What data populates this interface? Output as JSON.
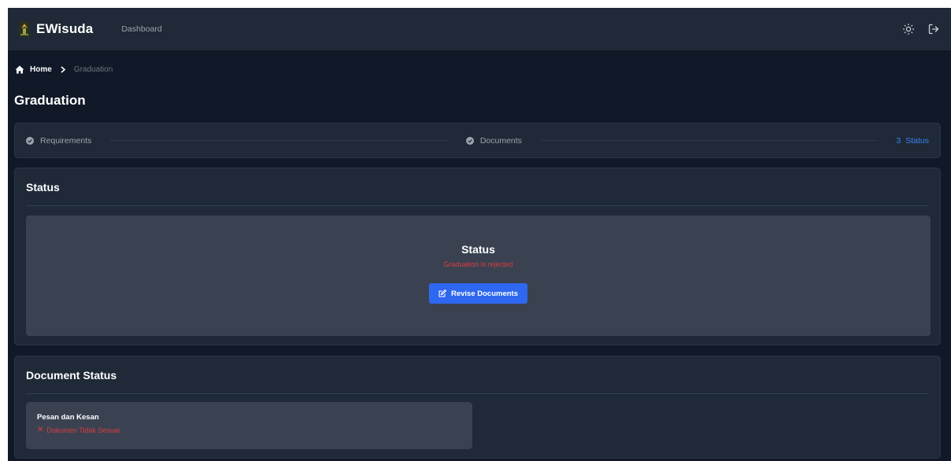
{
  "navbar": {
    "brand": "EWisuda",
    "nav_link": "Dashboard",
    "theme_icon": "sun-icon",
    "logout_icon": "logout-icon",
    "logo_icon": "graduation-logo-icon"
  },
  "breadcrumb": {
    "home": "Home",
    "current": "Graduation"
  },
  "page": {
    "title": "Graduation"
  },
  "stepper": {
    "steps": [
      {
        "label": "Requirements",
        "state": "complete"
      },
      {
        "label": "Documents",
        "state": "complete"
      },
      {
        "number": "3",
        "label": "Status",
        "state": "active"
      }
    ]
  },
  "status_card": {
    "header": "Status",
    "title": "Status",
    "message": "Graduation is rejected",
    "button_label": "Revise Documents"
  },
  "document_status": {
    "header": "Document Status",
    "items": [
      {
        "name": "Pesan dan Kesan",
        "status_mark": "✕",
        "status": "Dokumen Tidak Sesuai"
      }
    ]
  },
  "colors": {
    "background": "#111827",
    "navbar": "#1f2937",
    "card": "#1f2937",
    "panel": "#3a4252",
    "accent": "#2e67f0",
    "active_step": "#3b82f6",
    "error": "#dc3c3c"
  }
}
